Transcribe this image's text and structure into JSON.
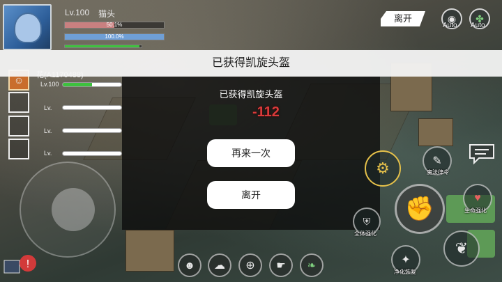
{
  "player": {
    "level": "Lv.100",
    "name": "猫头",
    "hp_text": "50.1%",
    "hp_fraction": 0.501,
    "mp_text": "100.0%",
    "mp_fraction": 1.0,
    "xp_fraction": 0.97
  },
  "top_right": {
    "leave_label": "离开",
    "auto1_label": "Auto",
    "auto2_label": "Auto"
  },
  "banner": {
    "title": "已获得凯旋头盔"
  },
  "team": {
    "members": [
      {
        "name": "花(A1170488)",
        "level": "Lv.100",
        "hp_fraction": 0.5
      },
      {
        "name": "",
        "level": "Lv.",
        "hp_fraction": 0
      },
      {
        "name": "",
        "level": "Lv.",
        "hp_fraction": 0
      },
      {
        "name": "",
        "level": "Lv.",
        "hp_fraction": 0
      }
    ]
  },
  "modal": {
    "message": "已获得凯旋头盔",
    "retry_label": "再来一次",
    "leave_label": "离开"
  },
  "damage_text": "-112",
  "skills": {
    "magic_order": "魔法律令",
    "life_boost": "生命强化",
    "body_boost": "全体强化",
    "purify": "净化恢复"
  },
  "colors": {
    "hp": "#c98080",
    "mp": "#6f9fd6",
    "xp": "#3ec13e",
    "damage": "#d93a3a"
  }
}
